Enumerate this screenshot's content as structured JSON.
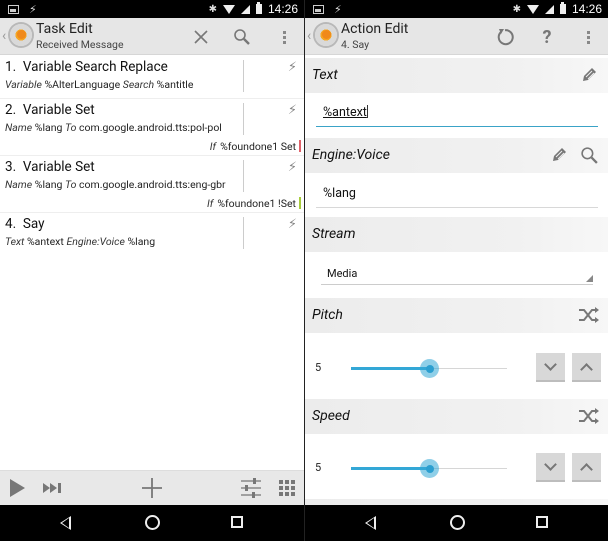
{
  "status_bar": {
    "time": "14:26",
    "left_icons": [
      "image-notification-icon",
      "tasker-bolt-icon"
    ],
    "right_icons": [
      "bluetooth-icon",
      "wifi-icon",
      "signal-icon",
      "battery-icon"
    ]
  },
  "left_screen": {
    "action_bar": {
      "title": "Task Edit",
      "subtitle": "Received Message",
      "actions": [
        "close-icon",
        "search-icon",
        "overflow-menu-icon"
      ]
    },
    "tasks": [
      {
        "number": "1.",
        "name": "Variable Search Replace",
        "args": [
          {
            "label": "Variable",
            "value": "%AlterLanguage"
          },
          {
            "label": "Search",
            "value": "%antitle"
          }
        ]
      },
      {
        "number": "2.",
        "name": "Variable Set",
        "args": [
          {
            "label": "Name",
            "value": "%lang"
          },
          {
            "label": "To",
            "value": "com.google.android.tts:pol-pol"
          }
        ],
        "condition": {
          "label": "If",
          "value": "%foundone1 Set",
          "color": "#e0626a"
        }
      },
      {
        "number": "3.",
        "name": "Variable Set",
        "args": [
          {
            "label": "Name",
            "value": "%lang"
          },
          {
            "label": "To",
            "value": "com.google.android.tts:eng-gbr"
          }
        ],
        "condition": {
          "label": "If",
          "value": "%foundone1 !Set",
          "color": "#a8cc3c"
        }
      },
      {
        "number": "4.",
        "name": "Say",
        "args": [
          {
            "label": "Text",
            "value": "%antext"
          },
          {
            "label": "Engine:Voice",
            "value": "%lang"
          }
        ]
      }
    ],
    "bottom_toolbar": [
      "play-icon",
      "step-forward-icon",
      "add-icon",
      "settings-sliders-icon",
      "grid-icon"
    ]
  },
  "right_screen": {
    "action_bar": {
      "title": "Action Edit",
      "subtitle": "4. Say",
      "actions": [
        "reset-icon",
        "help-icon",
        "overflow-menu-icon"
      ]
    },
    "fields": {
      "text": {
        "label": "Text",
        "prefix": "%",
        "value_underlined": "antext"
      },
      "engine_voice": {
        "label": "Engine:Voice",
        "value": "%lang"
      },
      "stream": {
        "label": "Stream",
        "selected": "Media"
      },
      "pitch": {
        "label": "Pitch",
        "value": "5",
        "fraction": 0.5
      },
      "speed": {
        "label": "Speed",
        "value": "5",
        "fraction": 0.5
      }
    },
    "accent_color": "#33a7d6"
  },
  "nav_bar": [
    "back-icon",
    "home-icon",
    "recents-icon"
  ]
}
